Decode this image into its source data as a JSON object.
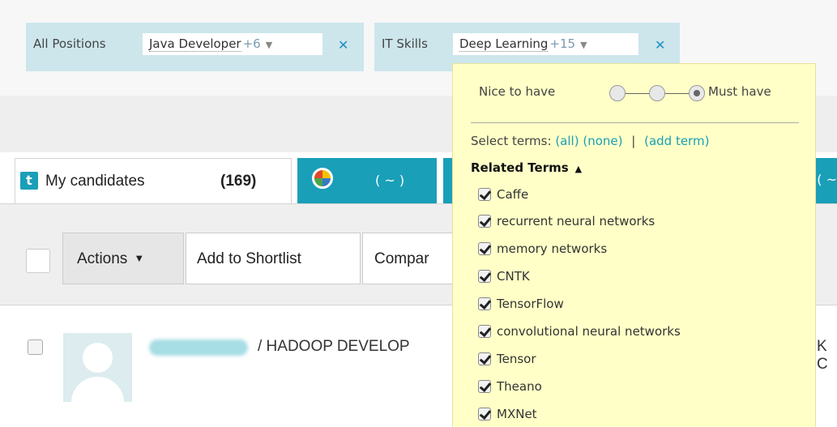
{
  "filters": [
    {
      "label": "All Positions",
      "value": "Java Developer",
      "count": "+6"
    },
    {
      "label": "IT Skills",
      "value": "Deep Learning",
      "count": "+15"
    }
  ],
  "icons": {
    "remove": "close-icon",
    "dropdown": "caret-down-icon",
    "logo": "talent-icon"
  },
  "tabs": {
    "my_candidates": {
      "badge": "t",
      "label": "My candidates",
      "count": "(169)"
    },
    "second": {
      "count": "( ~ )"
    },
    "third": {
      "count": "( ~"
    }
  },
  "toolbar": {
    "actions_label": "Actions",
    "shortlist_label": "Add to Shortlist",
    "compare_label": "Compar"
  },
  "candidate": {
    "title": "/  HADOOP DEVELOP",
    "title_tail": "K C"
  },
  "popup": {
    "nice_to_have": "Nice to have",
    "must_have": "Must have",
    "importance_level": "must_have",
    "select_terms": "Select terms:",
    "all": "(all)",
    "none": "(none)",
    "sep": "|",
    "add_term": "(add term)",
    "related_terms": "Related Terms",
    "terms": [
      "Caffe",
      "recurrent neural networks",
      "memory networks",
      "CNTK",
      "TensorFlow",
      "convolutional neural networks",
      "Tensor",
      "Theano",
      "MXNet"
    ]
  },
  "colors": {
    "accent": "#1a9fb8",
    "chip_bg": "#cde6ec",
    "popup_bg": "#ffffc7",
    "remove_x": "#1d8fc4"
  }
}
